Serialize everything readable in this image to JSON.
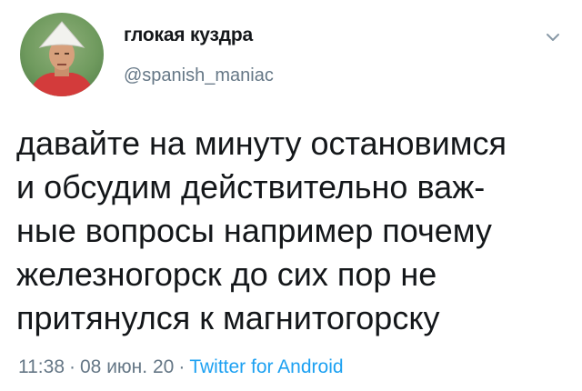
{
  "author": {
    "display_name": "глокая куздра",
    "handle": "@spanish_maniac"
  },
  "tweet": {
    "lines": [
      "давайте на минуту остановимся",
      "и обсудим действительно важ-",
      "ные вопросы например почему",
      "железногорск до сих пор не",
      "притянулся к магнитогорску"
    ]
  },
  "meta": {
    "time": "11:38",
    "separator": "·",
    "date": "08 июн. 20",
    "source": "Twitter for Android"
  },
  "icons": {
    "caret": "chevron-down-icon",
    "avatar": "avatar"
  },
  "colors": {
    "text": "#14171a",
    "secondary": "#657786",
    "link": "#1da1f2"
  }
}
